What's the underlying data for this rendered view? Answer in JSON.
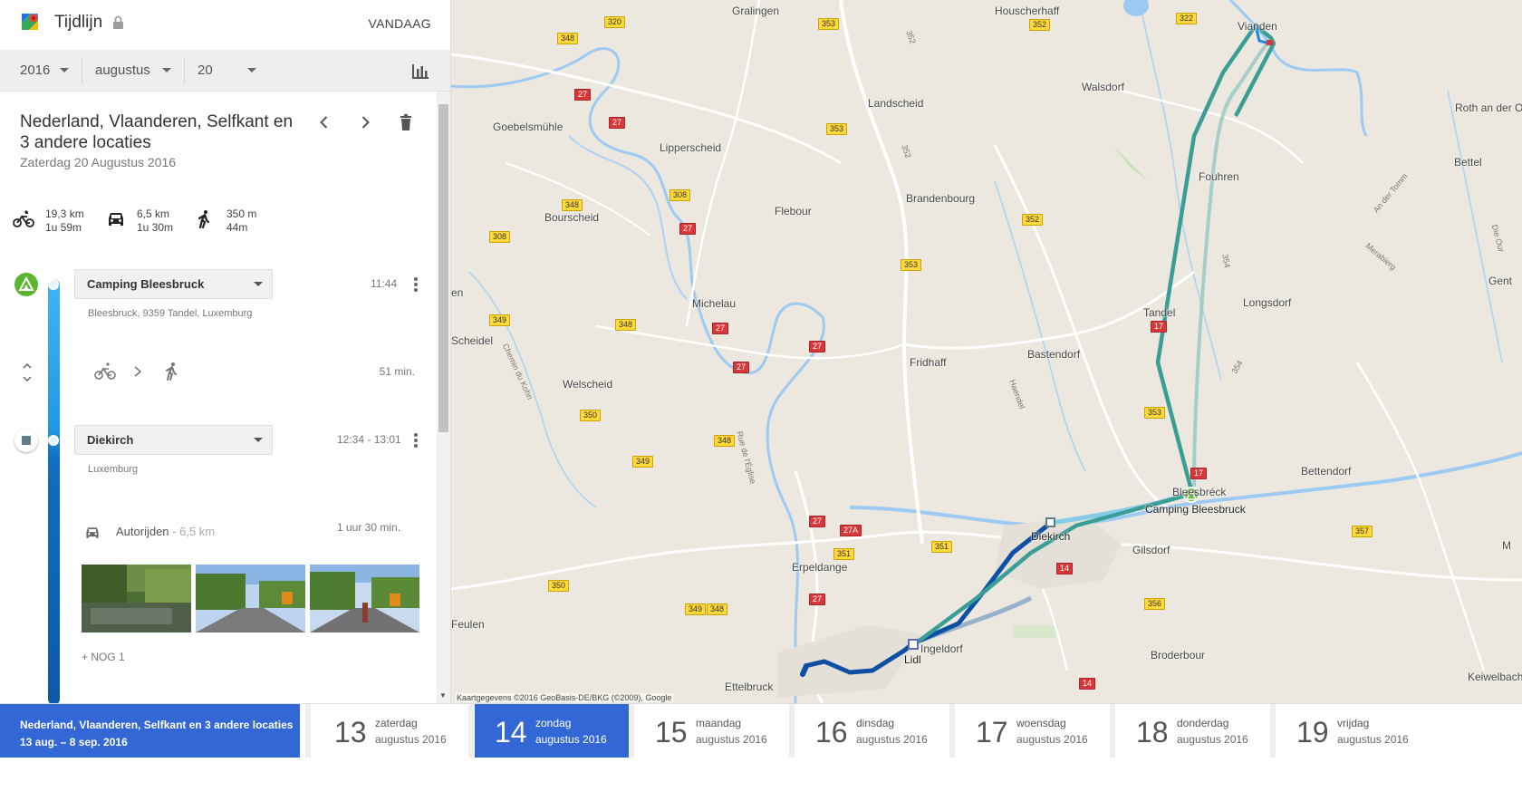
{
  "header": {
    "title": "Tijdlijn",
    "today_label": "VANDAAG"
  },
  "date_select": {
    "year": "2016",
    "month": "augustus",
    "day": "20"
  },
  "day": {
    "title": "Nederland, Vlaanderen, Selfkant en 3 andere locaties",
    "date": "Zaterdag 20 Augustus 2016"
  },
  "summary": [
    {
      "icon": "bicycle-icon",
      "distance": "19,3 km",
      "duration": "1u 59m"
    },
    {
      "icon": "car-icon",
      "distance": "6,5 km",
      "duration": "1u 30m"
    },
    {
      "icon": "walking-icon",
      "distance": "350 m",
      "duration": "44m"
    }
  ],
  "timeline": {
    "place1": {
      "name": "Camping Bleesbruck",
      "address": "Bleesbruck, 9359 Tandel, Luxemburg",
      "time": "11:44"
    },
    "move1": {
      "duration": "51 min."
    },
    "place2": {
      "name": "Diekirch",
      "address": "Luxemburg",
      "time": "12:34 - 13:01"
    },
    "activity": {
      "label": "Autorijden",
      "distance": "6,5 km",
      "duration": "1 uur 30 min."
    },
    "more_photos": "+ NOG 1"
  },
  "map": {
    "attribution": "Kaartgegevens ©2016 GeoBasis-DE/BKG (©2009), Google",
    "towns": [
      "Gralingen",
      "Houscherhaff",
      "Vianden",
      "Walsdorf",
      "Roth an der Our",
      "Landscheid",
      "Goebelsmühle",
      "Lipperscheid",
      "Bettel",
      "Fouhren",
      "Brandenbourg",
      "Flebour",
      "Bourscheid",
      "Michelau",
      "Longsdorf",
      "Tandel",
      "Scheidel",
      "Bastendorf",
      "Fridhaff",
      "Welscheid",
      "Bleesbréck",
      "Camping Bleesbruck",
      "Bettendorf",
      "Diekirch",
      "Gilsdorf",
      "Erpeldange",
      "Feulen",
      "Ingeldorf",
      "Lidl",
      "Broderbour",
      "Ettelbruck",
      "Keiwelbach",
      "Gent",
      "en",
      "M",
      "Rue de l'Église",
      "Chemin du Kohn",
      "Haendel",
      "Merabierg",
      "An der Tomm",
      "Die Our"
    ],
    "shields_yellow": [
      "320",
      "353",
      "352",
      "322",
      "348",
      "353",
      "352",
      "348",
      "308",
      "308",
      "353",
      "349",
      "348",
      "350",
      "353",
      "349",
      "348",
      "351",
      "351",
      "350",
      "349",
      "348",
      "356",
      "357"
    ],
    "shields_red": [
      "27",
      "27",
      "27",
      "27",
      "27",
      "27",
      "27",
      "27",
      "27A",
      "17",
      "17",
      "14",
      "14"
    ],
    "route_nums": [
      "352",
      "352",
      "354",
      "354"
    ]
  },
  "strip": {
    "range_title": "Nederland, Vlaanderen, Selfkant en 3 andere locaties",
    "range_dates": "13 aug. – 8 sep. 2016",
    "days": [
      {
        "num": "13",
        "name": "zaterdag",
        "month": "augustus 2016"
      },
      {
        "num": "14",
        "name": "zondag",
        "month": "augustus 2016"
      },
      {
        "num": "15",
        "name": "maandag",
        "month": "augustus 2016"
      },
      {
        "num": "16",
        "name": "dinsdag",
        "month": "augustus 2016"
      },
      {
        "num": "17",
        "name": "woensdag",
        "month": "augustus 2016"
      },
      {
        "num": "18",
        "name": "donderdag",
        "month": "augustus 2016"
      },
      {
        "num": "19",
        "name": "vrijdag",
        "month": "augustus 2016"
      }
    ]
  },
  "colors": {
    "accent": "#3367d6",
    "route_bike": "#3a9e97",
    "route_car": "#0d4fa3",
    "camp_green": "#5cb531"
  }
}
